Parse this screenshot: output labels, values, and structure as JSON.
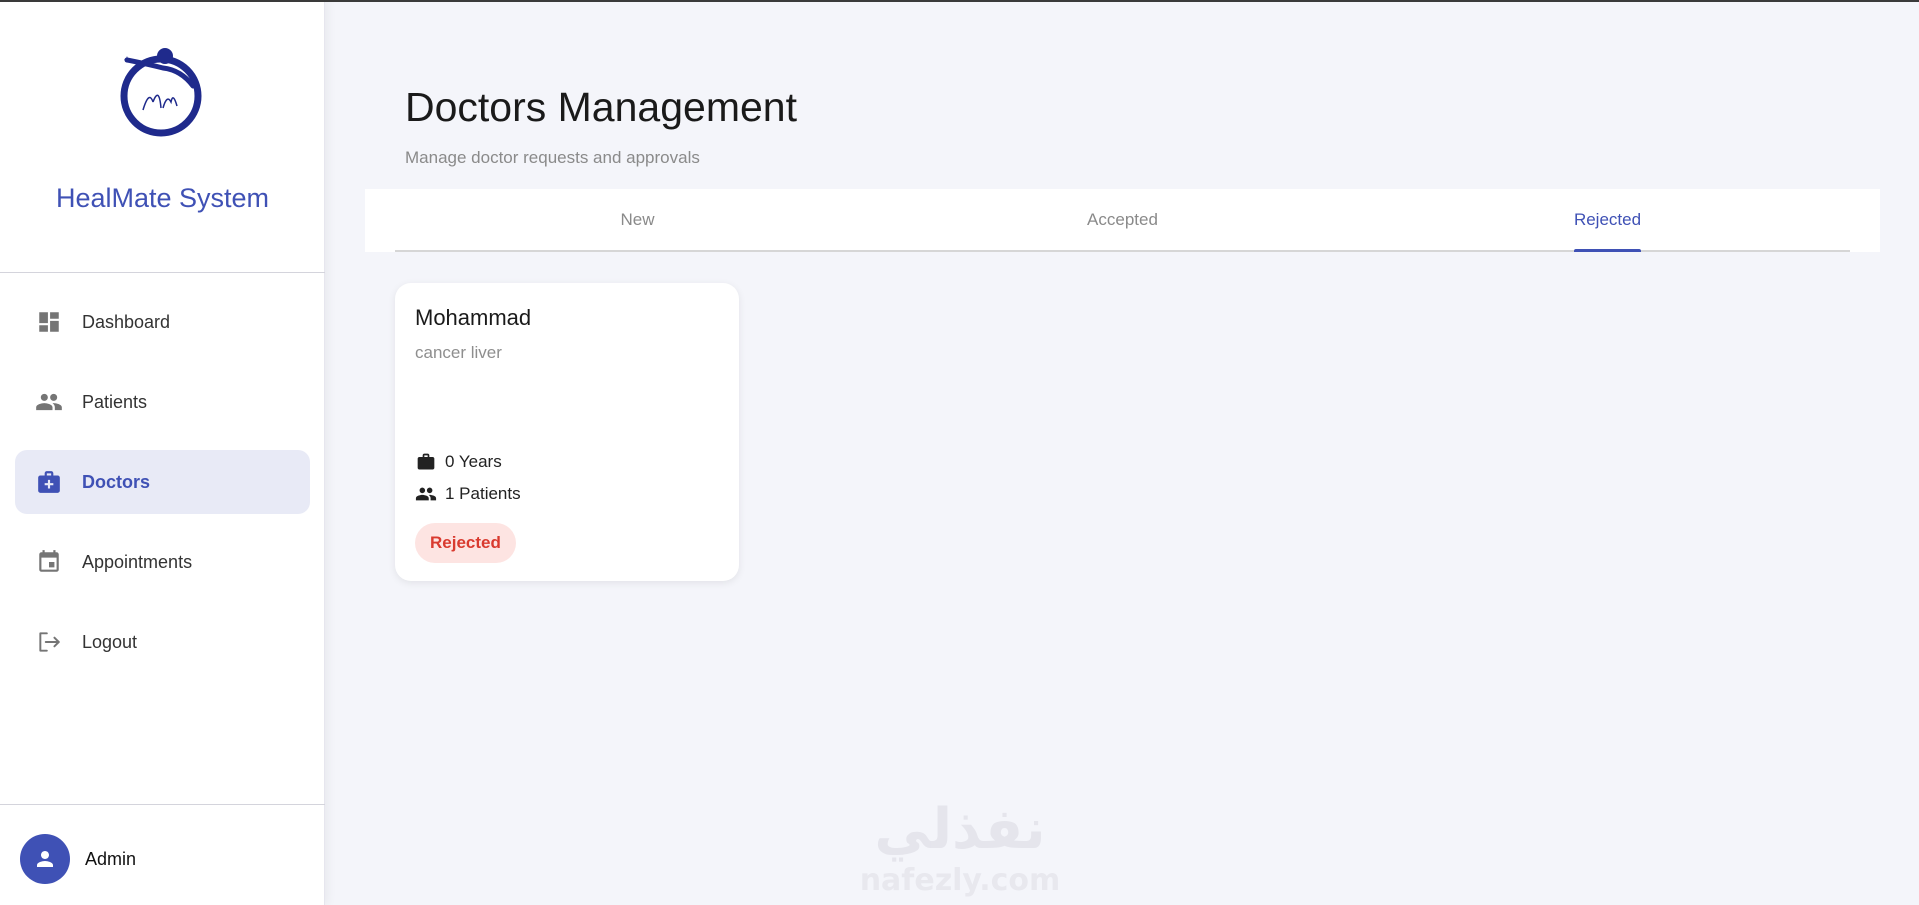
{
  "sidebar": {
    "brand": "HealMate System",
    "items": [
      {
        "label": "Dashboard",
        "icon": "dashboard-icon",
        "active": false
      },
      {
        "label": "Patients",
        "icon": "people-icon",
        "active": false
      },
      {
        "label": "Doctors",
        "icon": "medical-bag-icon",
        "active": true
      },
      {
        "label": "Appointments",
        "icon": "calendar-icon",
        "active": false
      },
      {
        "label": "Logout",
        "icon": "logout-icon",
        "active": false
      }
    ],
    "user": {
      "name": "Admin",
      "icon": "person-icon"
    }
  },
  "header": {
    "title": "Doctors Management",
    "subtitle": "Manage doctor requests and approvals"
  },
  "tabs": [
    {
      "label": "New",
      "active": false
    },
    {
      "label": "Accepted",
      "active": false
    },
    {
      "label": "Rejected",
      "active": true
    }
  ],
  "doctors": [
    {
      "name": "Mohammad",
      "specialty": "cancer liver",
      "experience": "0 Years",
      "patients": "1 Patients",
      "status": "Rejected"
    }
  ],
  "watermark": {
    "arabic": "نفذلي",
    "latin": "nafezly.com"
  },
  "colors": {
    "accent": "#3f51b5",
    "rejected_bg": "#fde4e2",
    "rejected_text": "#d93a2f"
  }
}
